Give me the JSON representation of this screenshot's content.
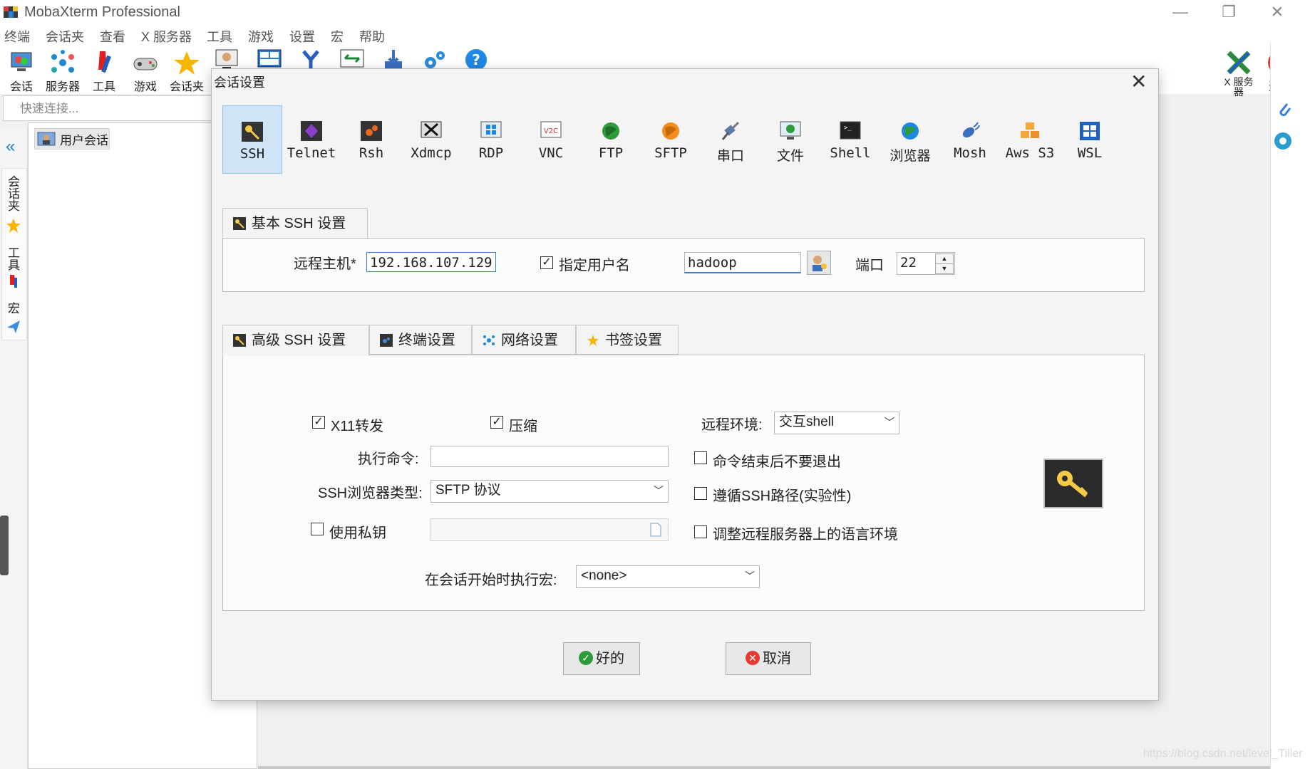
{
  "app": {
    "title": "MobaXterm Professional"
  },
  "menu": [
    "终端",
    "会话夹",
    "查看",
    "X 服务器",
    "工具",
    "游戏",
    "设置",
    "宏",
    "帮助"
  ],
  "toolbar": {
    "items": [
      {
        "label": "会话",
        "icon": "session-icon"
      },
      {
        "label": "服务器",
        "icon": "servers-icon"
      },
      {
        "label": "工具",
        "icon": "tools-icon"
      },
      {
        "label": "游戏",
        "icon": "games-icon"
      },
      {
        "label": "会话夹",
        "icon": "star-icon"
      }
    ],
    "right": [
      {
        "label": "X 服务\n器",
        "icon": "x-server-icon"
      },
      {
        "label": "退出",
        "icon": "power-icon"
      }
    ]
  },
  "quick_connect": {
    "placeholder": "快速连接..."
  },
  "side_tabs": [
    "会话夹",
    "工具",
    "宏"
  ],
  "sessions": {
    "user_sessions": "用户会话"
  },
  "dialog": {
    "title": "会话设置",
    "protocols": [
      "SSH",
      "Telnet",
      "Rsh",
      "Xdmcp",
      "RDP",
      "VNC",
      "FTP",
      "SFTP",
      "串口",
      "文件",
      "Shell",
      "浏览器",
      "Mosh",
      "Aws S3",
      "WSL"
    ],
    "selected_protocol": "SSH",
    "basic_tab": "基本 SSH 设置",
    "remote_host_label": "远程主机*",
    "remote_host_value": "192.168.107.129",
    "specify_user_label": "指定用户名",
    "specify_user_checked": true,
    "username_value": "hadoop",
    "port_label": "端口",
    "port_value": "22",
    "adv_tabs": [
      "高级 SSH 设置",
      "终端设置",
      "网络设置",
      "书签设置"
    ],
    "x11_label": "X11转发",
    "x11_checked": true,
    "compress_label": "压缩",
    "compress_checked": true,
    "remote_env_label": "远程环境:",
    "remote_env_value": "交互shell",
    "exec_cmd_label": "执行命令:",
    "exec_cmd_value": "",
    "no_exit_label": "命令结束后不要退出",
    "browser_type_label": "SSH浏览器类型:",
    "browser_type_value": "SFTP 协议",
    "follow_path_label": "遵循SSH路径(实验性)",
    "private_key_label": "使用私钥",
    "private_key_value": "",
    "adjust_locale_label": "调整远程服务器上的语言环境",
    "macro_label": "在会话开始时执行宏:",
    "macro_value": "<none>",
    "ok_label": "好的",
    "cancel_label": "取消"
  },
  "watermark": "https://blog.csdn.net/level_Tiller"
}
